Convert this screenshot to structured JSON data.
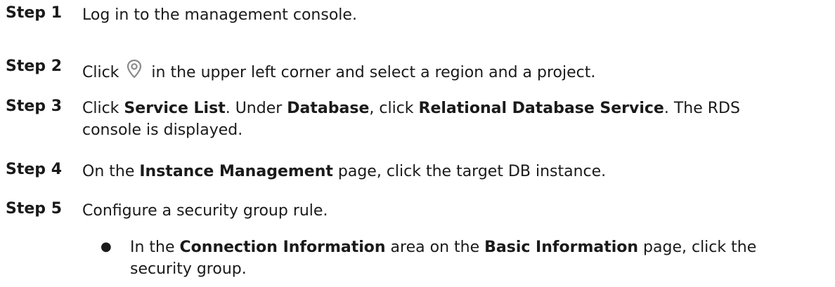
{
  "steps": [
    {
      "label": "Step 1",
      "text": "Log in to the management console."
    },
    {
      "label": "Step 2",
      "text_before": "Click",
      "icon": "location-pin-icon",
      "text_after": "in the upper left corner and select a region and a project."
    },
    {
      "label": "Step 3",
      "t1": "Click ",
      "b1": "Service List",
      "t2": ". Under ",
      "b2": "Database",
      "t3": ", click ",
      "b3": "Relational Database Service",
      "t4": ". The RDS",
      "line2": "console is displayed."
    },
    {
      "label": "Step 4",
      "t1": "On the ",
      "b1": "Instance Management",
      "t2": " page, click the target DB instance."
    },
    {
      "label": "Step 5",
      "text": "Configure a security group rule.",
      "bullet": {
        "symbol": "●",
        "t1": "In the ",
        "b1": "Connection Information",
        "t2": " area on the ",
        "b2": "Basic Information",
        "t3": " page, click the",
        "line2": "security group."
      }
    }
  ]
}
